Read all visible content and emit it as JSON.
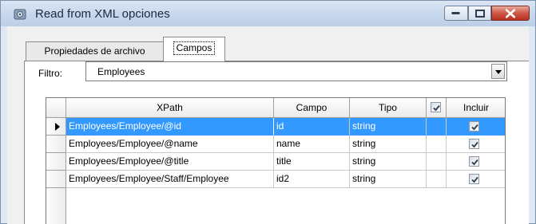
{
  "window": {
    "title": "Read from XML opciones",
    "icon": "gear-window-icon"
  },
  "tabs": [
    {
      "label": "Propiedades de archivo",
      "active": false
    },
    {
      "label": "Campos",
      "active": true
    }
  ],
  "filter": {
    "label": "Filtro:",
    "value": "Employees"
  },
  "grid": {
    "columns": {
      "xpath": "XPath",
      "campo": "Campo",
      "tipo": "Tipo",
      "incluir": "Incluir"
    },
    "header_checkbox_checked": true,
    "rows": [
      {
        "xpath": "Employees/Employee/@id",
        "campo": "id",
        "tipo": "string",
        "incluir": true,
        "selected": true
      },
      {
        "xpath": "Employees/Employee/@name",
        "campo": "name",
        "tipo": "string",
        "incluir": true,
        "selected": false
      },
      {
        "xpath": "Employees/Employee/@title",
        "campo": "title",
        "tipo": "string",
        "incluir": true,
        "selected": false
      },
      {
        "xpath": "Employees/Employee/Staff/Employee",
        "campo": "id2",
        "tipo": "string",
        "incluir": true,
        "selected": false
      }
    ]
  },
  "colors": {
    "selection": "#3399ff",
    "titlebar": "#c7d7ec",
    "close_button": "#c8453a"
  }
}
